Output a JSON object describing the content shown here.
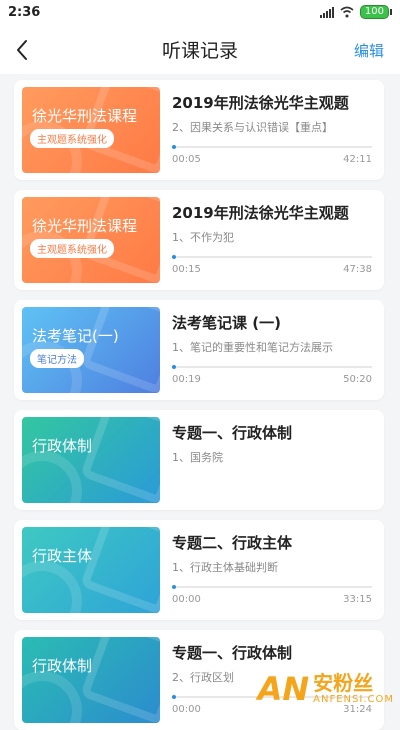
{
  "status": {
    "time": "2:36",
    "battery": "100"
  },
  "nav": {
    "title": "听课记录",
    "edit_label": "编辑"
  },
  "courses": [
    {
      "thumb_title": "徐光华刑法课程",
      "thumb_tag": "主观题系统强化",
      "title": "2019年刑法徐光华主观题",
      "subtitle": "2、因果关系与认识错误【重点】",
      "progress": 0.01,
      "current": "00:05",
      "duration": "42:11"
    },
    {
      "thumb_title": "徐光华刑法课程",
      "thumb_tag": "主观题系统强化",
      "title": "2019年刑法徐光华主观题",
      "subtitle": "1、不作为犯",
      "progress": 0.01,
      "current": "00:15",
      "duration": "47:38"
    },
    {
      "thumb_title": "法考笔记(一)",
      "thumb_tag": "笔记方法",
      "title": "法考笔记课 (一)",
      "subtitle": "1、笔记的重要性和笔记方法展示",
      "progress": 0.01,
      "current": "00:19",
      "duration": "50:20"
    },
    {
      "thumb_title": "行政体制",
      "thumb_tag": "",
      "title": "专题一、行政体制",
      "subtitle": "1、国务院",
      "progress": null,
      "current": "",
      "duration": ""
    },
    {
      "thumb_title": "行政主体",
      "thumb_tag": "",
      "title": "专题二、行政主体",
      "subtitle": "1、行政主体基础判断",
      "progress": 0.0,
      "current": "00:00",
      "duration": "33:15"
    },
    {
      "thumb_title": "行政体制",
      "thumb_tag": "",
      "title": "专题一、行政体制",
      "subtitle": "2、行政区划",
      "progress": 0.01,
      "current": "00:00",
      "duration": "31:24"
    }
  ],
  "watermark": {
    "logo": "AN",
    "cn": "安粉丝",
    "en": "ANFENSI.COM"
  },
  "colors": {
    "accent": "#2a8fe3",
    "watermark": "#f4a51c"
  }
}
